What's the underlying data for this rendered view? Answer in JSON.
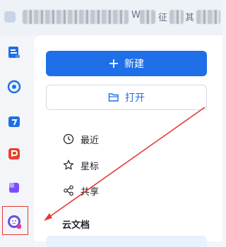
{
  "header": {
    "obscured_title_fragments": [
      "W",
      "征",
      "其"
    ]
  },
  "rail": {
    "items": [
      {
        "name": "docs-icon",
        "color": "#1e6fe8"
      },
      {
        "name": "chat-icon",
        "color": "#1e6fe8"
      },
      {
        "name": "calendar-icon",
        "color": "#1e6fe8"
      },
      {
        "name": "pdf-icon",
        "color": "#e8402e"
      },
      {
        "name": "apps-icon",
        "color": "#7c4dff"
      },
      {
        "name": "assistant-icon",
        "color": "#6b4ce6"
      }
    ]
  },
  "main": {
    "new_label": "新建",
    "open_label": "打开",
    "nav": [
      {
        "label": "最近",
        "icon": "clock-icon"
      },
      {
        "label": "星标",
        "icon": "star-icon"
      },
      {
        "label": "共享",
        "icon": "share-icon"
      }
    ],
    "section_title": "云文档"
  },
  "colors": {
    "accent": "#1e6fe8",
    "annotation": "#e53935"
  }
}
